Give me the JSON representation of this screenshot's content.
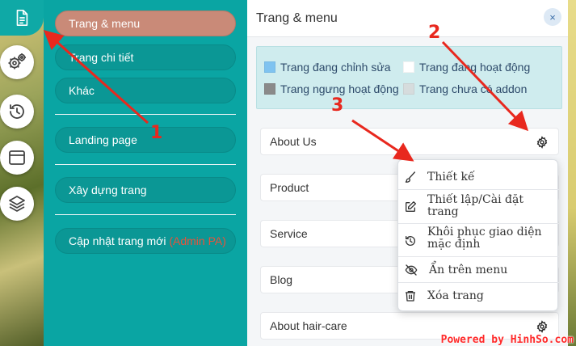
{
  "menu": {
    "items": [
      {
        "label": "Trang & menu",
        "active": true
      },
      {
        "label": "Trang chi tiết",
        "active": false
      },
      {
        "label": "Khác",
        "active": false
      },
      {
        "label": "Landing page",
        "active": false
      },
      {
        "label": "Xây dựng trang",
        "active": false
      }
    ],
    "update_label": "Cập nhật trang mới",
    "update_admin": "(Admin PA)"
  },
  "panel": {
    "title": "Trang & menu",
    "close_glyph": "×"
  },
  "legend": [
    {
      "label": "Trang đang chỉnh sửa",
      "color": "#7fc3f0"
    },
    {
      "label": "Trang đang hoạt động",
      "color": "#ffffff"
    },
    {
      "label": "Trang ngưng hoạt động",
      "color": "#8a8a8a"
    },
    {
      "label": "Trang chưa có addon",
      "color": "#d6dcdd"
    }
  ],
  "pages": [
    {
      "name": "About Us"
    },
    {
      "name": "Product"
    },
    {
      "name": "Service"
    },
    {
      "name": "Blog"
    },
    {
      "name": "About hair-care"
    }
  ],
  "page_menu": [
    {
      "label": "Thiết kế",
      "icon": "brush-icon"
    },
    {
      "label": "Thiết lập/Cài đặt trang",
      "line1": "Thiết lập/Cài đặt",
      "line2": "trang",
      "icon": "edit-icon"
    },
    {
      "label": "Khôi phục giao diện mặc định",
      "line1": "Khôi phục giao diện",
      "line2": "mặc định",
      "icon": "history-icon"
    },
    {
      "label": "Ẩn trên menu",
      "icon": "eye-off-icon"
    },
    {
      "label": "Xóa trang",
      "icon": "trash-icon"
    }
  ],
  "annotations": [
    "1",
    "2",
    "3"
  ],
  "watermark": "Powered by HinhSo.com",
  "colors": {
    "teal": "#0aa5a3",
    "active_item": "#c98a78",
    "annotation": "#e8281e"
  }
}
